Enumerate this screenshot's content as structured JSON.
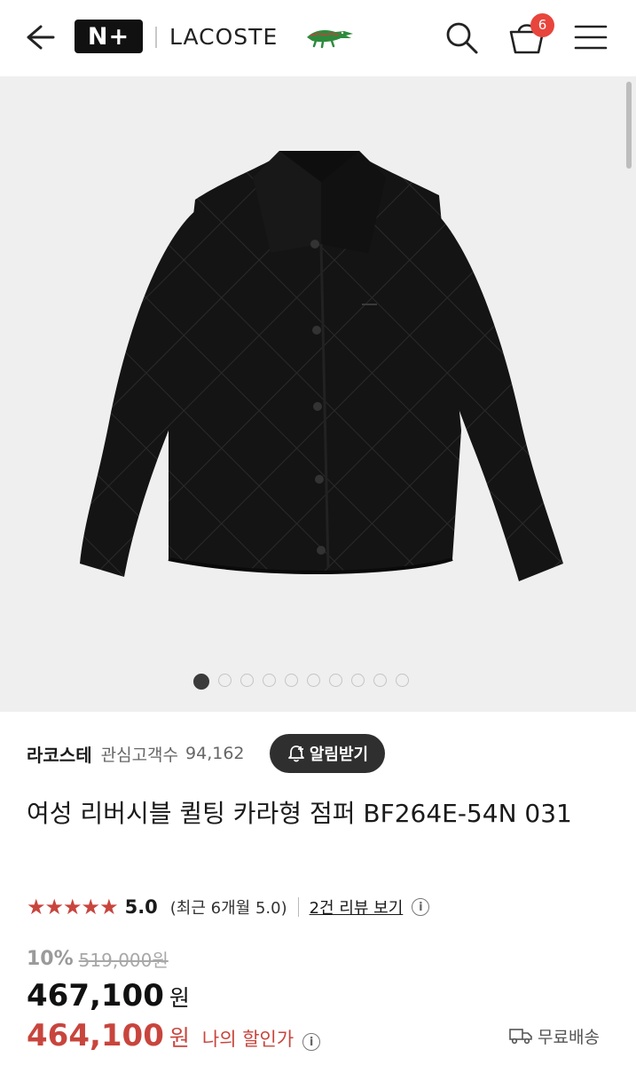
{
  "header": {
    "badge_text": "N+",
    "brand_name": "LACOSTE",
    "cart_count": "6",
    "icons": [
      "back-arrow-icon",
      "search-icon",
      "shopping-bag-icon",
      "hamburger-menu-icon",
      "crocodile-logo-icon"
    ]
  },
  "gallery": {
    "image_count": 10,
    "active_index": 0
  },
  "product": {
    "brand": "라코스테",
    "fav_label": "관심고객수",
    "fav_count": "94,162",
    "alert_button": "알림받기",
    "title": "여성 리버시블 퀼팅 카라형 점퍼 BF264E-54N 031",
    "stars": "★★★★★",
    "rating": "5.0",
    "recent_rating": "(최근 6개월 5.0)",
    "review_link": "2건 리뷰 보기",
    "discount": "10%",
    "original_price": "519,000원",
    "price": "467,100",
    "price_unit": "원",
    "my_price": "464,100",
    "my_price_unit": "원",
    "my_price_label": "나의 할인가",
    "shipping": "무료배송"
  },
  "colors": {
    "accent_red": "#c8453d",
    "badge_red": "#e8453c",
    "dark_button": "#2f2f2f"
  }
}
